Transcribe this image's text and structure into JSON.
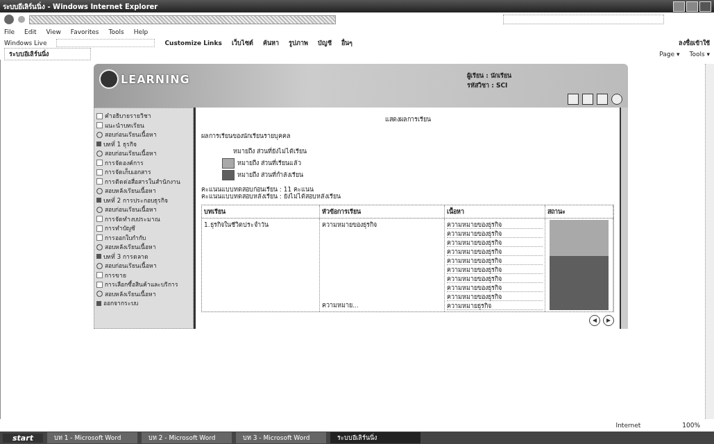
{
  "window": {
    "title": "ระบบอีเลิร์นนิ่ง - Windows Internet Explorer"
  },
  "menu": [
    "File",
    "Edit",
    "View",
    "Favorites",
    "Tools",
    "Help"
  ],
  "live_bar": {
    "label": "Windows Live",
    "links": [
      "Customize Links",
      "เว็บไซต์",
      "ค้นหา",
      "รูปภาพ",
      "บัญชี",
      "อื่นๆ"
    ],
    "right": "ลงชื่อเข้าใช้"
  },
  "tab": {
    "label": "ระบบอีเลิร์นนิ่ง"
  },
  "command_bar": [
    "Page ▾",
    "Tools ▾"
  ],
  "page": {
    "logo": "LEARNING",
    "user_lines": [
      "ผู้เรียน : นักเรียน",
      "รหัสวิชา : SCI"
    ],
    "sidebar": [
      {
        "kind": "page",
        "label": "คำอธิบายรายวิชา"
      },
      {
        "kind": "page",
        "label": "แนะนำบทเรียน"
      },
      {
        "kind": "test",
        "label": "สอบก่อนเรียนเนื้อหา"
      },
      {
        "kind": "folder",
        "label": "บทที่ 1 ธุรกิจ"
      },
      {
        "kind": "test",
        "label": "สอบก่อนเรียนเนื้อหา"
      },
      {
        "kind": "page",
        "label": "การจัดองค์การ"
      },
      {
        "kind": "page",
        "label": "การจัดเก็บเอกสาร"
      },
      {
        "kind": "page",
        "label": "การติดต่อสื่อสารในสำนักงาน"
      },
      {
        "kind": "test",
        "label": "สอบหลังเรียนเนื้อหา"
      },
      {
        "kind": "folder",
        "label": "บทที่ 2 การประกอบธุรกิจ"
      },
      {
        "kind": "test",
        "label": "สอบก่อนเรียนเนื้อหา"
      },
      {
        "kind": "page",
        "label": "การจัดทำงบประมาณ"
      },
      {
        "kind": "page",
        "label": "การทำบัญชี"
      },
      {
        "kind": "page",
        "label": "การออกใบกำกับ"
      },
      {
        "kind": "test",
        "label": "สอบหลังเรียนเนื้อหา"
      },
      {
        "kind": "folder",
        "label": "บทที่ 3 การตลาด"
      },
      {
        "kind": "test",
        "label": "สอบก่อนเรียนเนื้อหา"
      },
      {
        "kind": "page",
        "label": "การขาย"
      },
      {
        "kind": "page",
        "label": "การเลือกซื้อสินค้าและบริการ"
      },
      {
        "kind": "test",
        "label": "สอบหลังเรียนเนื้อหา"
      },
      {
        "kind": "folder",
        "label": "ออกจากระบบ"
      }
    ],
    "heading": "แสดงผลการเรียน",
    "intro": "ผลการเรียนของนักเรียนรายบุคคล",
    "legend_title": "หมายถึง ส่วนที่ยังไม่ได้เรียน",
    "legend": [
      {
        "learned": true,
        "label": "หมายถึง ส่วนที่เรียนแล้ว"
      },
      {
        "learned": false,
        "label": "หมายถึง ส่วนที่กำลังเรียน"
      }
    ],
    "scores": [
      "คะแนนแบบทดสอบก่อนเรียน : 11 คะแนน",
      "คะแนนแบบทดสอบหลังเรียน : ยังไม่ได้สอบหลังเรียน"
    ],
    "table": {
      "columns": [
        "บทเรียน",
        "หัวข้อการเรียน",
        "เนื้อหา",
        "สถานะ"
      ],
      "lesson": "1.ธุรกิจในชีวิตประจำวัน",
      "topic": "ความหมายของธุรกิจ",
      "topic_2": "ความหมาย...",
      "contents": [
        {
          "label": "ความหมายของธุรกิจ",
          "learned": true
        },
        {
          "label": "ความหมายของธุรกิจ",
          "learned": true
        },
        {
          "label": "ความหมายของธุรกิจ",
          "learned": true
        },
        {
          "label": "ความหมายของธุรกิจ",
          "learned": true
        },
        {
          "label": "ความหมายของธุรกิจ",
          "learned": false
        },
        {
          "label": "ความหมายของธุรกิจ",
          "learned": false
        },
        {
          "label": "ความหมายของธุรกิจ",
          "learned": false
        },
        {
          "label": "ความหมายของธุรกิจ",
          "learned": false
        },
        {
          "label": "ความหมายของธุรกิจ",
          "learned": false
        },
        {
          "label": "ความหมายธุรกิจ",
          "learned": false
        }
      ]
    }
  },
  "status_bar": {
    "zone": "Internet",
    "zoom": "100%"
  },
  "taskbar": {
    "start": "start",
    "items": [
      {
        "label": "บท 1 - Microsoft Word",
        "selected": false
      },
      {
        "label": "บท 2 - Microsoft Word",
        "selected": false
      },
      {
        "label": "บท 3 - Microsoft Word",
        "selected": false
      },
      {
        "label": "ระบบอีเลิร์นนิ่ง",
        "selected": true
      }
    ]
  }
}
